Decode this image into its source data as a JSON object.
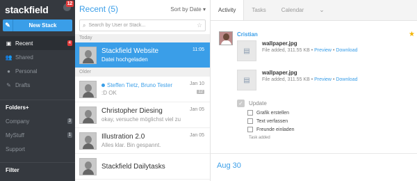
{
  "brand": {
    "name": "stackfield",
    "notification_count": "12"
  },
  "sidebar": {
    "new_stack_label": "New Stack",
    "items": [
      {
        "label": "Recent",
        "count": "4",
        "active": true
      },
      {
        "label": "Shared"
      },
      {
        "label": "Personal"
      },
      {
        "label": "Drafts"
      }
    ],
    "folders_header": "Folders",
    "folders": [
      {
        "label": "Company",
        "count": "3"
      },
      {
        "label": "MyStuff",
        "count": "1"
      },
      {
        "label": "Support"
      }
    ],
    "filter_header": "Filter"
  },
  "recent": {
    "title": "Recent (5)",
    "sort_label": "Sort by Date",
    "search_placeholder": "Search by User or Stack...",
    "group_today": "Today",
    "group_older": "Older",
    "items": [
      {
        "title": "Stackfield Website",
        "sub": "Datei hochgeladen",
        "date": "11:05",
        "selected": true
      },
      {
        "title": "Steffen Tietz, Bruno Tester",
        "sub": ":D OK",
        "date": "Jan 10",
        "count": "12"
      },
      {
        "title": "Christopher Diesing",
        "sub": "okay, versuche möglichst viel zu",
        "date": "Jan 05"
      },
      {
        "title": "Illustration 2.0",
        "sub": "Alles klar. Bin gespannt.",
        "date": "Jan 05"
      },
      {
        "title": "Stackfield Dailytasks",
        "sub": "",
        "date": ""
      }
    ]
  },
  "detail": {
    "tabs": [
      "Activity",
      "Tasks",
      "Calendar",
      "⌄"
    ],
    "author": "Cristian",
    "files": [
      {
        "name": "wallpaper.jpg",
        "meta": "File added, 311.55 KB • ",
        "preview": "Preview",
        "sep": " • ",
        "download": "Download"
      },
      {
        "name": "wallpaper.jpg",
        "meta": "File added, 311.55 KB • ",
        "preview": "Preview",
        "sep": " • ",
        "download": "Download"
      }
    ],
    "task": {
      "title": "Update",
      "items": [
        "Grafik erstellen",
        "Text verfassen",
        "Freunde einladen"
      ],
      "footer": "Task added"
    },
    "date_separator": "Aug 30"
  }
}
